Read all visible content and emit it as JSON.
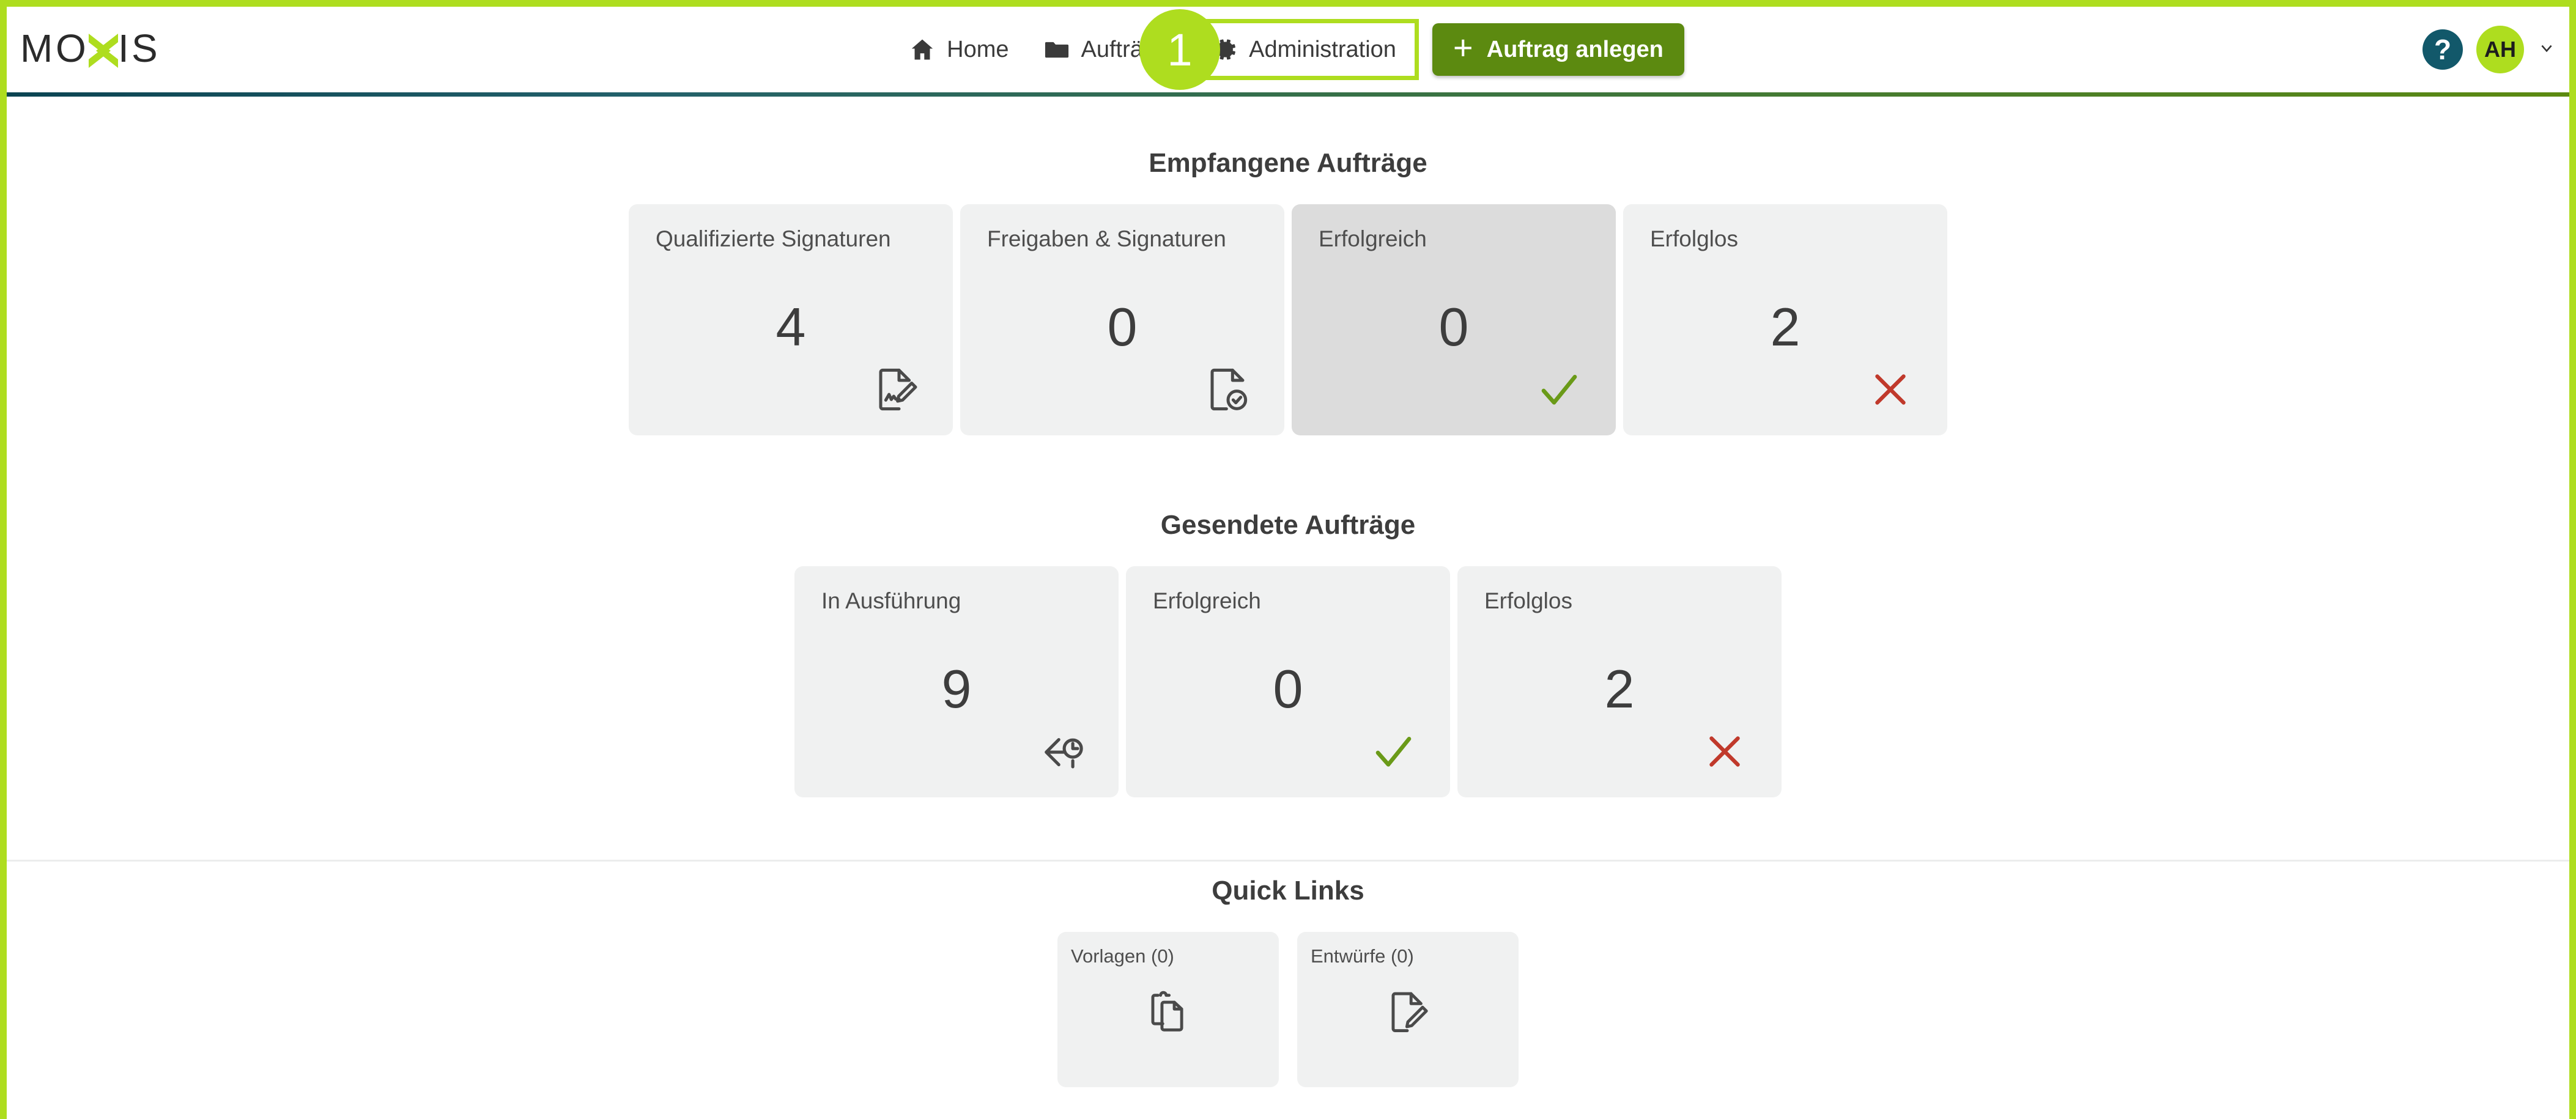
{
  "brand": {
    "logo_text": "MOXIS",
    "accent_green": "#AEDD1F",
    "dark_green": "#5C8A10",
    "teal": "#12586A"
  },
  "header": {
    "nav": [
      {
        "label": "Home",
        "icon": "home-icon"
      },
      {
        "label": "Aufträge",
        "icon": "folder-icon"
      },
      {
        "label": "Administration",
        "icon": "gear-icon"
      }
    ],
    "create_button": {
      "label": "Auftrag anlegen",
      "icon": "plus-icon"
    },
    "callout_badge": "1",
    "help": "?",
    "avatar_initials": "AH",
    "caret": "chevron-down-icon"
  },
  "sections": [
    {
      "title": "Empfangene Aufträge",
      "cards": [
        {
          "label": "Qualifizierte Signaturen",
          "value": "4",
          "icon": "document-signature-icon",
          "state": "default"
        },
        {
          "label": "Freigaben & Signaturen",
          "value": "0",
          "icon": "document-check-icon",
          "state": "default"
        },
        {
          "label": "Erfolgreich",
          "value": "0",
          "icon": "check-icon",
          "state": "hover"
        },
        {
          "label": "Erfolglos",
          "value": "2",
          "icon": "cross-icon",
          "state": "default"
        }
      ]
    },
    {
      "title": "Gesendete Aufträge",
      "cards": [
        {
          "label": "In Ausführung",
          "value": "9",
          "icon": "arrow-clock-icon",
          "state": "default"
        },
        {
          "label": "Erfolgreich",
          "value": "0",
          "icon": "check-icon",
          "state": "default"
        },
        {
          "label": "Erfolglos",
          "value": "2",
          "icon": "cross-icon",
          "state": "default"
        }
      ]
    }
  ],
  "quick_links": {
    "title": "Quick Links",
    "cards": [
      {
        "label": "Vorlagen (0)",
        "icon": "template-copy-icon"
      },
      {
        "label": "Entwürfe (0)",
        "icon": "document-pencil-icon"
      }
    ]
  },
  "colors": {
    "success_green": "#6A9A18",
    "error_red": "#C0392B",
    "card_bg": "#f0f1f1",
    "card_bg_hover": "#dcdcdc"
  }
}
